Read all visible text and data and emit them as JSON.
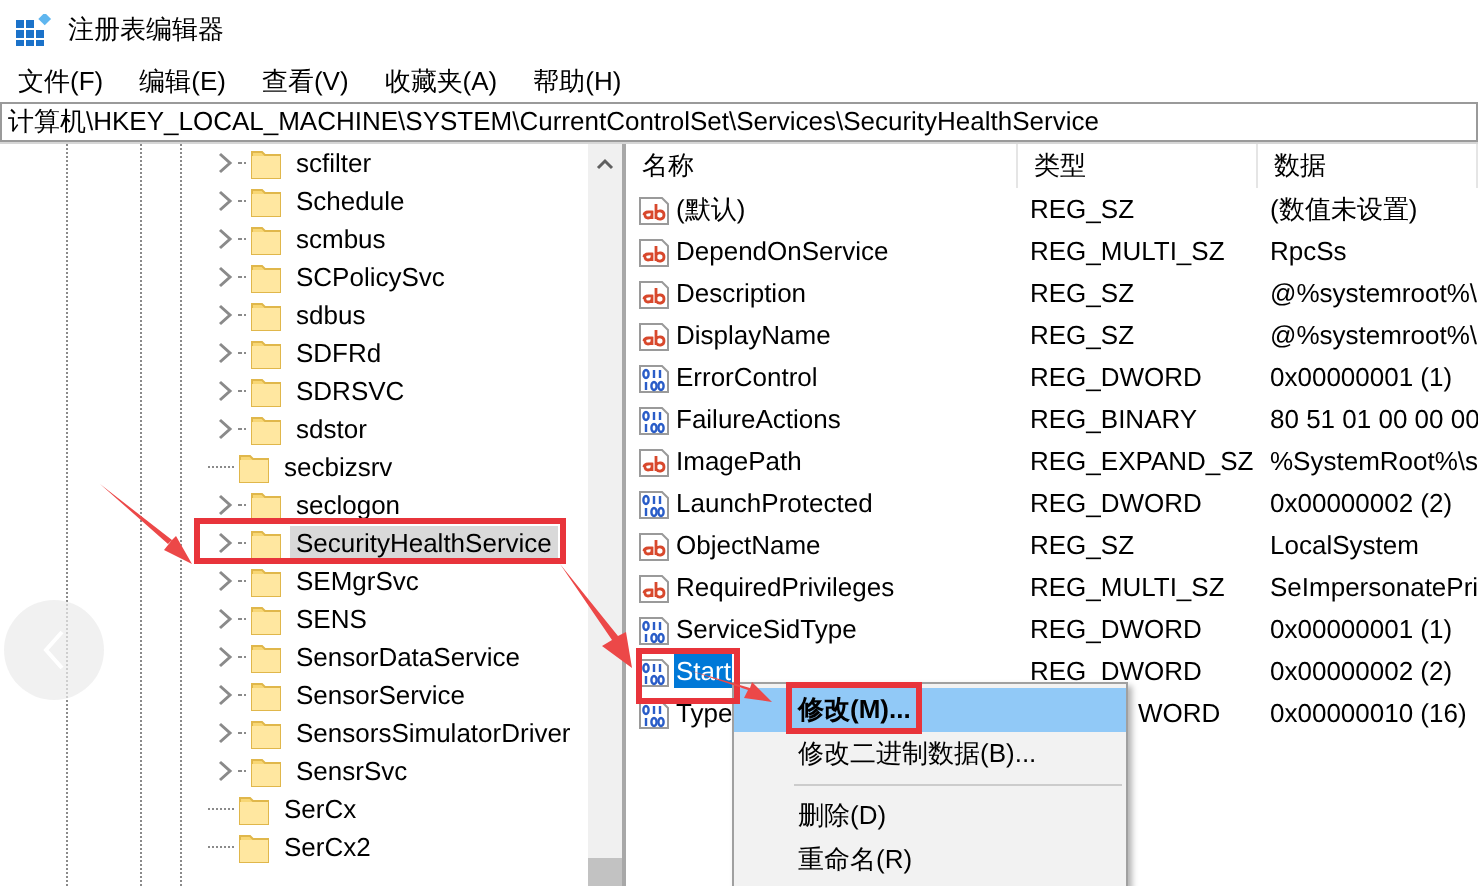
{
  "window": {
    "title": "注册表编辑器"
  },
  "menu": [
    {
      "label": "文件(F)"
    },
    {
      "label": "编辑(E)"
    },
    {
      "label": "查看(V)"
    },
    {
      "label": "收藏夹(A)"
    },
    {
      "label": "帮助(H)"
    }
  ],
  "address": "计算机\\HKEY_LOCAL_MACHINE\\SYSTEM\\CurrentControlSet\\Services\\SecurityHealthService",
  "tree": [
    {
      "name": "scfilter",
      "expandable": true,
      "selected": false
    },
    {
      "name": "Schedule",
      "expandable": true,
      "selected": false
    },
    {
      "name": "scmbus",
      "expandable": true,
      "selected": false
    },
    {
      "name": "SCPolicySvc",
      "expandable": true,
      "selected": false
    },
    {
      "name": "sdbus",
      "expandable": true,
      "selected": false
    },
    {
      "name": "SDFRd",
      "expandable": true,
      "selected": false
    },
    {
      "name": "SDRSVC",
      "expandable": true,
      "selected": false
    },
    {
      "name": "sdstor",
      "expandable": true,
      "selected": false
    },
    {
      "name": "secbizsrv",
      "expandable": false,
      "selected": false
    },
    {
      "name": "seclogon",
      "expandable": true,
      "selected": false
    },
    {
      "name": "SecurityHealthService",
      "expandable": true,
      "selected": true
    },
    {
      "name": "SEMgrSvc",
      "expandable": true,
      "selected": false
    },
    {
      "name": "SENS",
      "expandable": true,
      "selected": false
    },
    {
      "name": "SensorDataService",
      "expandable": true,
      "selected": false
    },
    {
      "name": "SensorService",
      "expandable": true,
      "selected": false
    },
    {
      "name": "SensorsSimulatorDriver",
      "expandable": true,
      "selected": false
    },
    {
      "name": "SensrSvc",
      "expandable": true,
      "selected": false
    },
    {
      "name": "SerCx",
      "expandable": false,
      "selected": false
    },
    {
      "name": "SerCx2",
      "expandable": false,
      "selected": false
    }
  ],
  "list": {
    "columns": [
      "名称",
      "类型",
      "数据"
    ],
    "rows": [
      {
        "kind": "string",
        "name": "(默认)",
        "type": "REG_SZ",
        "data": "(数值未设置)",
        "selected": false
      },
      {
        "kind": "string",
        "name": "DependOnService",
        "type": "REG_MULTI_SZ",
        "data": "RpcSs",
        "selected": false
      },
      {
        "kind": "string",
        "name": "Description",
        "type": "REG_SZ",
        "data": "@%systemroot%\\",
        "selected": false
      },
      {
        "kind": "string",
        "name": "DisplayName",
        "type": "REG_SZ",
        "data": "@%systemroot%\\",
        "selected": false
      },
      {
        "kind": "binary",
        "name": "ErrorControl",
        "type": "REG_DWORD",
        "data": "0x00000001 (1)",
        "selected": false
      },
      {
        "kind": "binary",
        "name": "FailureActions",
        "type": "REG_BINARY",
        "data": "80 51 01 00 00 00",
        "selected": false
      },
      {
        "kind": "string",
        "name": "ImagePath",
        "type": "REG_EXPAND_SZ",
        "data": "%SystemRoot%\\s",
        "selected": false
      },
      {
        "kind": "binary",
        "name": "LaunchProtected",
        "type": "REG_DWORD",
        "data": "0x00000002 (2)",
        "selected": false
      },
      {
        "kind": "string",
        "name": "ObjectName",
        "type": "REG_SZ",
        "data": "LocalSystem",
        "selected": false
      },
      {
        "kind": "string",
        "name": "RequiredPrivileges",
        "type": "REG_MULTI_SZ",
        "data": "SeImpersonatePri",
        "selected": false
      },
      {
        "kind": "binary",
        "name": "ServiceSidType",
        "type": "REG_DWORD",
        "data": "0x00000001 (1)",
        "selected": false
      },
      {
        "kind": "binary",
        "name": "Start",
        "type": "REG_DWORD",
        "data": "0x00000002 (2)",
        "selected": true
      },
      {
        "kind": "binary",
        "name": "Type",
        "type": "WORD",
        "data": "0x00000010 (16)",
        "selected": false,
        "type_partly_covered": true
      }
    ]
  },
  "context_menu": {
    "items": [
      {
        "label": "修改(M)...",
        "selected": true,
        "separator_before": false
      },
      {
        "label": "修改二进制数据(B)...",
        "selected": false,
        "separator_before": false
      },
      {
        "label": "删除(D)",
        "selected": false,
        "separator_before": true
      },
      {
        "label": "重命名(R)",
        "selected": false,
        "separator_before": false
      }
    ]
  }
}
